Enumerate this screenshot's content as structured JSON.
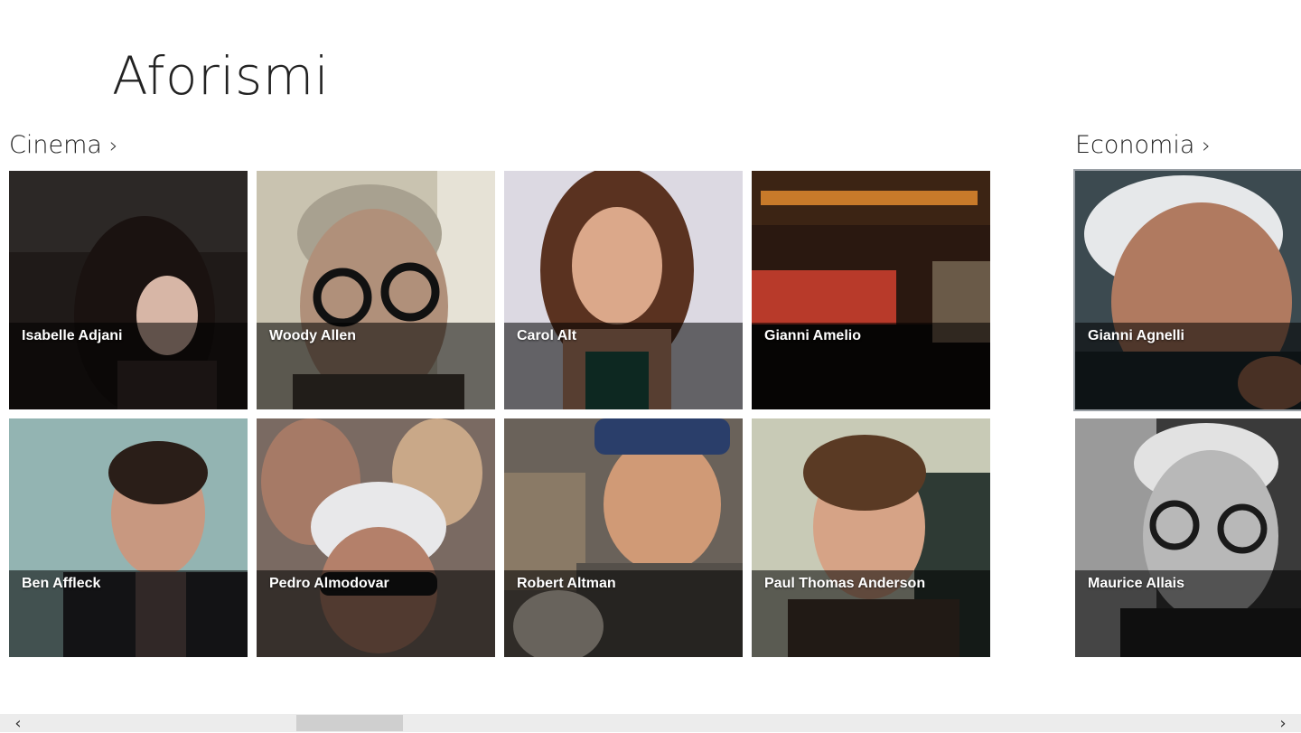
{
  "app": {
    "title": "Aforismi"
  },
  "groups": [
    {
      "name": "Cinema",
      "chevron": "›"
    },
    {
      "name": "Economia",
      "chevron": "›"
    }
  ],
  "tiles": {
    "cinema": [
      "Isabelle Adjani",
      "Woody Allen",
      "Carol Alt",
      "Gianni Amelio",
      "Ben Affleck",
      "Pedro Almodovar",
      "Robert Altman",
      "Paul Thomas Anderson"
    ],
    "economia": [
      "Gianni Agnelli",
      "Maurice Allais"
    ]
  },
  "selected_tile": "Gianni Agnelli",
  "scrollbar": {
    "left_arrow": "‹",
    "right_arrow": "›",
    "position_fraction": 0.23
  },
  "photo_colors": {
    "isabelle-adjani": "#2a2320",
    "woody-allen": "#8a7a62",
    "carol-alt": "#c9b4a0",
    "gianni-amelio": "#3a2416",
    "ben-affleck": "#7ea2a0",
    "pedro-almodovar": "#6a5a52",
    "robert-altman": "#6f6760",
    "paul-thomas-anderson": "#8f7a66",
    "gianni-agnelli": "#5a6a70",
    "maurice-allais": "#8a8a8a"
  }
}
